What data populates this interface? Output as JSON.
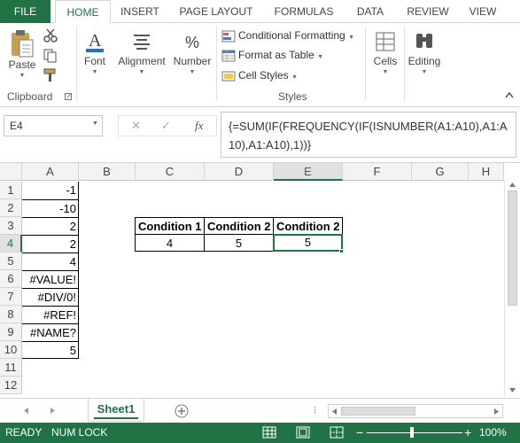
{
  "ribbon_tabs": [
    "FILE",
    "HOME",
    "INSERT",
    "PAGE LAYOUT",
    "FORMULAS",
    "DATA",
    "REVIEW",
    "VIEW"
  ],
  "ribbon": {
    "paste": "Paste",
    "clipboard_group": "Clipboard",
    "font": "Font",
    "alignment": "Alignment",
    "number": "Number",
    "conditional_formatting": "Conditional Formatting",
    "format_as_table": "Format as Table",
    "cell_styles": "Cell Styles",
    "styles_group": "Styles",
    "cells": "Cells",
    "editing": "Editing",
    "font_icon_glyph": "A",
    "number_icon_glyph": "%"
  },
  "formula_bar": {
    "name_box": "E4",
    "cancel_glyph": "✕",
    "enter_glyph": "✓",
    "fx_glyph": "fx",
    "formula": "{=SUM(IF(FREQUENCY(IF(ISNUMBER(A1:A10),A1:A10),A1:A10),1))}"
  },
  "columns": [
    "A",
    "B",
    "C",
    "D",
    "E",
    "F",
    "G",
    "H"
  ],
  "rows": [
    "1",
    "2",
    "3",
    "4",
    "5",
    "6",
    "7",
    "8",
    "9",
    "10",
    "11",
    "12"
  ],
  "column_a": [
    "-1",
    "-10",
    "2",
    "2",
    "4",
    "#VALUE!",
    "#DIV/0!",
    "#REF!",
    "#NAME?",
    "5"
  ],
  "table": {
    "headers": [
      "Condition 1",
      "Condition 2",
      "Condition 2"
    ],
    "values": [
      "4",
      "5",
      "5"
    ]
  },
  "sheet_tabs": [
    "Sheet1"
  ],
  "status": {
    "mode": "READY",
    "numlock": "NUM LOCK",
    "zoom": "100%",
    "zoom_minus": "−",
    "zoom_plus": "+"
  },
  "colors": {
    "accent": "#217346",
    "grid": "#d4d4d4"
  }
}
